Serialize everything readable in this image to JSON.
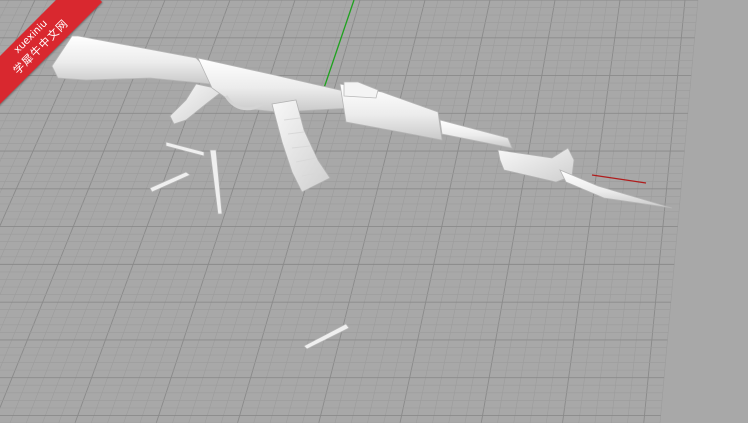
{
  "viewport": {
    "name": "perspective-viewport",
    "background": "#a8a8a8",
    "grid_minor_color": "#9c9c9c",
    "grid_major_color": "#8a8a8a",
    "axis_y_color": "#1fa21f",
    "axis_x_color": "#b01c1c",
    "model_color": "#ededed",
    "model_shadow": "#c4c4c4"
  },
  "watermark": {
    "line1": "xuexiniu",
    "line2": "学犀牛中文网",
    "color": "#d9282f"
  },
  "scene": {
    "objects": [
      "rifle-model",
      "magazine",
      "bayonet",
      "cartridge",
      "cartridge",
      "cartridge",
      "cartridge"
    ]
  }
}
